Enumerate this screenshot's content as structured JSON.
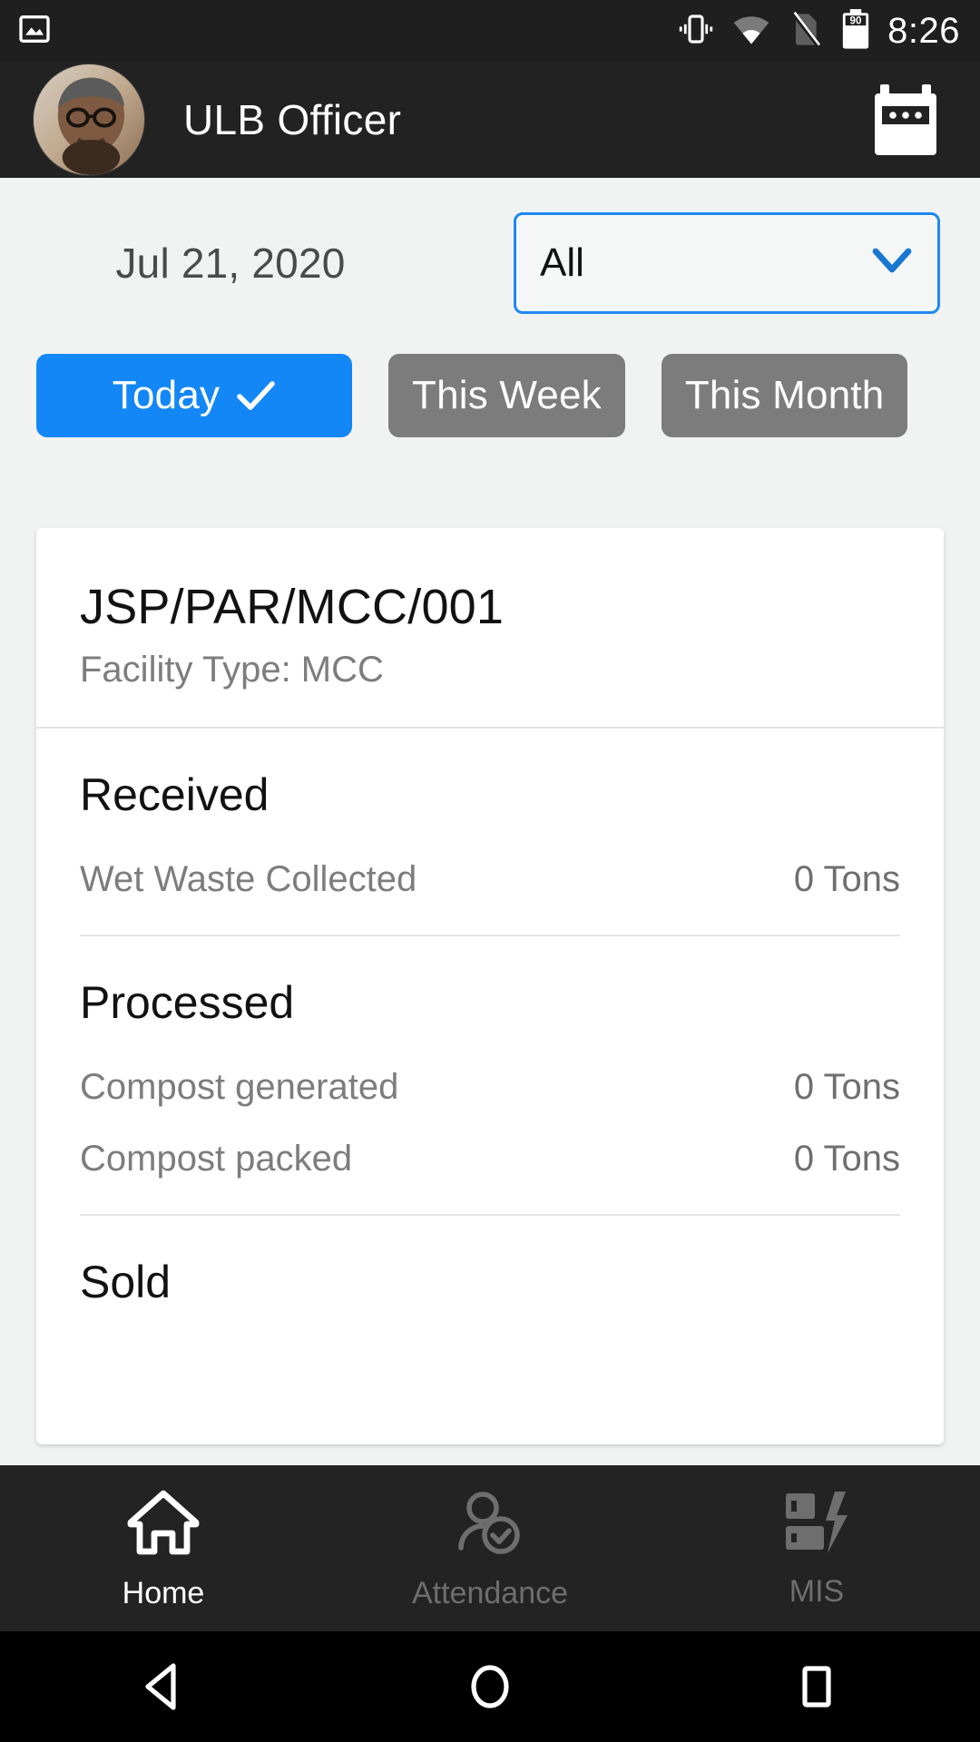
{
  "status_bar": {
    "notification_icon": "image-icon",
    "vibrate_icon": "vibrate-icon",
    "wifi_icon": "wifi-icon",
    "sim_icon": "no-sim-icon",
    "battery_level": "90",
    "time": "8:26"
  },
  "app_bar": {
    "avatar": "user-avatar",
    "title": "ULB Officer",
    "action_icon": "calendar-icon"
  },
  "filters": {
    "date": "Jul 21, 2020",
    "facility_select": {
      "value": "All",
      "options": [
        "All"
      ]
    },
    "chips": [
      {
        "label": "Today",
        "selected": true
      },
      {
        "label": "This Week",
        "selected": false
      },
      {
        "label": "This Month",
        "selected": false
      }
    ]
  },
  "card": {
    "title": "JSP/PAR/MCC/001",
    "subtitle": "Facility Type: MCC",
    "sections": [
      {
        "title": "Received",
        "rows": [
          {
            "label": "Wet Waste Collected",
            "value": "0 Tons"
          }
        ]
      },
      {
        "title": "Processed",
        "rows": [
          {
            "label": "Compost generated",
            "value": "0 Tons"
          },
          {
            "label": "Compost packed",
            "value": "0 Tons"
          }
        ]
      },
      {
        "title": "Sold",
        "rows": []
      }
    ]
  },
  "bottom_nav": [
    {
      "label": "Home",
      "icon": "home-icon",
      "active": true
    },
    {
      "label": "Attendance",
      "icon": "person-check-icon",
      "active": false
    },
    {
      "label": "MIS",
      "icon": "report-icon",
      "active": false
    }
  ],
  "system_nav": {
    "back": "back-triangle-icon",
    "home": "home-circle-icon",
    "recents": "recents-square-icon"
  },
  "colors": {
    "accent": "#1287f5",
    "chip_inactive": "#7c7c7c",
    "appbar_bg": "#222222",
    "page_bg": "#f1f3f3"
  }
}
